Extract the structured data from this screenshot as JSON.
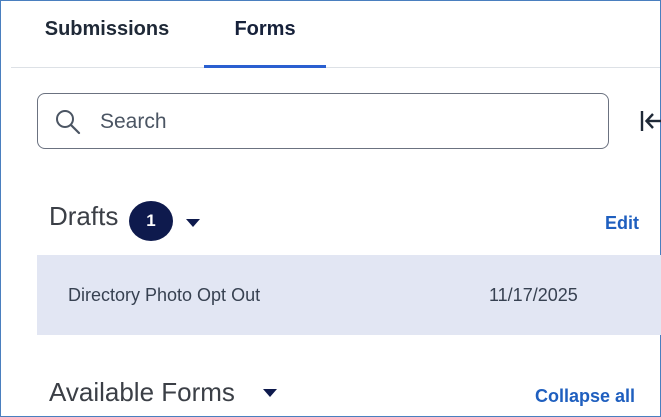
{
  "tabs": [
    {
      "label": "Submissions",
      "active": false
    },
    {
      "label": "Forms",
      "active": true
    }
  ],
  "search": {
    "placeholder": "Search"
  },
  "drafts": {
    "title": "Drafts",
    "count": "1",
    "edit_label": "Edit",
    "items": [
      {
        "name": "Directory Photo Opt Out",
        "date": "11/17/2025"
      }
    ]
  },
  "available_forms": {
    "title": "Available Forms",
    "collapse_label": "Collapse all"
  },
  "colors": {
    "accent": "#2a5fd0",
    "link": "#1f5fbf",
    "badge": "#0e1a4d",
    "row_highlight": "#e2e6f3"
  },
  "icons": [
    "search-icon",
    "collapse-panel-icon",
    "caret-down-icon"
  ]
}
